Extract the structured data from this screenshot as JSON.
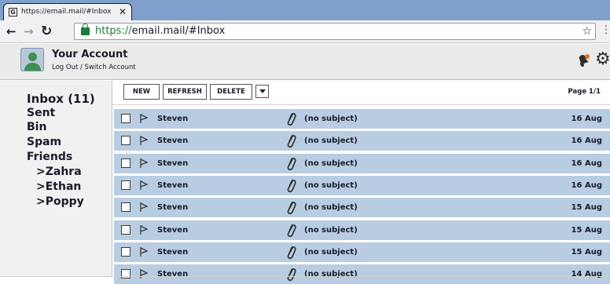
{
  "browser": {
    "tab_title": "https://email.mail/#Inbox",
    "tab_close": "✕",
    "url_secure": "https://",
    "url_rest": "email.mail/#Inbox"
  },
  "account": {
    "name": "Your Account",
    "sub": "Log Out / Switch Account"
  },
  "sidebar": {
    "folders": [
      {
        "label": "Inbox (11)"
      },
      {
        "label": "Sent"
      },
      {
        "label": "Bin"
      },
      {
        "label": "Spam"
      },
      {
        "label": "Friends"
      },
      {
        "label": ">Zahra"
      },
      {
        "label": ">Ethan"
      },
      {
        "label": ">Poppy"
      }
    ]
  },
  "toolbar": {
    "new_label": "NEW",
    "refresh_label": "REFRESH",
    "delete_label": "DELETE",
    "page_info": "Page 1/1"
  },
  "emails": [
    {
      "sender": "Steven",
      "subject": "(no subject)",
      "date": "16 Aug"
    },
    {
      "sender": "Steven",
      "subject": "(no subject)",
      "date": "16 Aug"
    },
    {
      "sender": "Steven",
      "subject": "(no subject)",
      "date": "16 Aug"
    },
    {
      "sender": "Steven",
      "subject": "(no subject)",
      "date": "16 Aug"
    },
    {
      "sender": "Steven",
      "subject": "(no subject)",
      "date": "15 Aug"
    },
    {
      "sender": "Steven",
      "subject": "(no subject)",
      "date": "15 Aug"
    },
    {
      "sender": "Steven",
      "subject": "(no subject)",
      "date": "15 Aug"
    },
    {
      "sender": "Steven",
      "subject": "(no subject)",
      "date": "14 Aug"
    }
  ],
  "colors": {
    "tabstrip": "#7f9fcc",
    "row_background": "#b8cde2",
    "secure_green": "#1d7a3b"
  },
  "icons": [
    "browser-favicon-icon",
    "back-icon",
    "forward-icon",
    "reload-icon",
    "lock-icon",
    "star-icon",
    "menu-dots-icon",
    "notification-bell-icon",
    "gear-icon",
    "flag-icon",
    "paperclip-icon",
    "chevron-down-icon"
  ]
}
